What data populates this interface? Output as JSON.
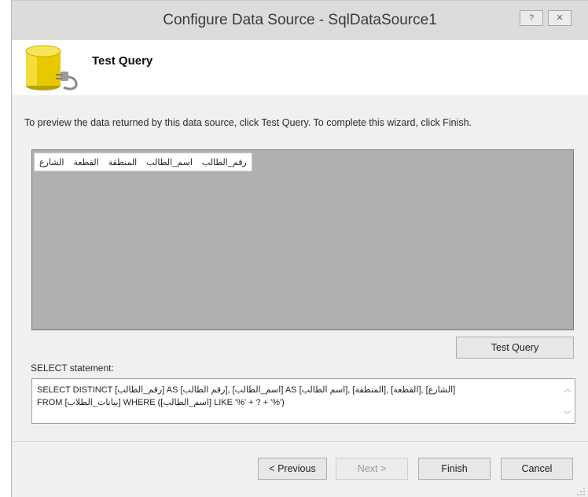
{
  "window": {
    "title": "Configure Data Source - SqlDataSource1",
    "help_glyph": "?",
    "close_glyph": "✕"
  },
  "header": {
    "title": "Test Query",
    "icon": "database-icon"
  },
  "instructions": "To preview the data returned by this data source, click Test Query. To complete this wizard, click Finish.",
  "results": {
    "columns": [
      "رقم_الطالب",
      "اسم_الطالب",
      "المنطقة",
      "القطعة",
      "الشارع"
    ]
  },
  "buttons": {
    "test_query": "Test Query",
    "previous": "< Previous",
    "next": "Next >",
    "finish": "Finish",
    "cancel": "Cancel"
  },
  "select_statement": {
    "label": "SELECT statement:",
    "line1": "SELECT DISTINCT [رقم_الطالب] AS [رقم الطالب], [اسم_الطالب] AS [اسم الطالب], [المنطقة], [القطعة], [الشارع]",
    "line2": "FROM [بيانات_الطلاب] WHERE ([اسم_الطالب] LIKE '%' + ? + '%')"
  },
  "colors": {
    "window_bg": "#f0f0f0",
    "grid_bg": "#b0b0b0",
    "header_bg": "#ffffff"
  }
}
